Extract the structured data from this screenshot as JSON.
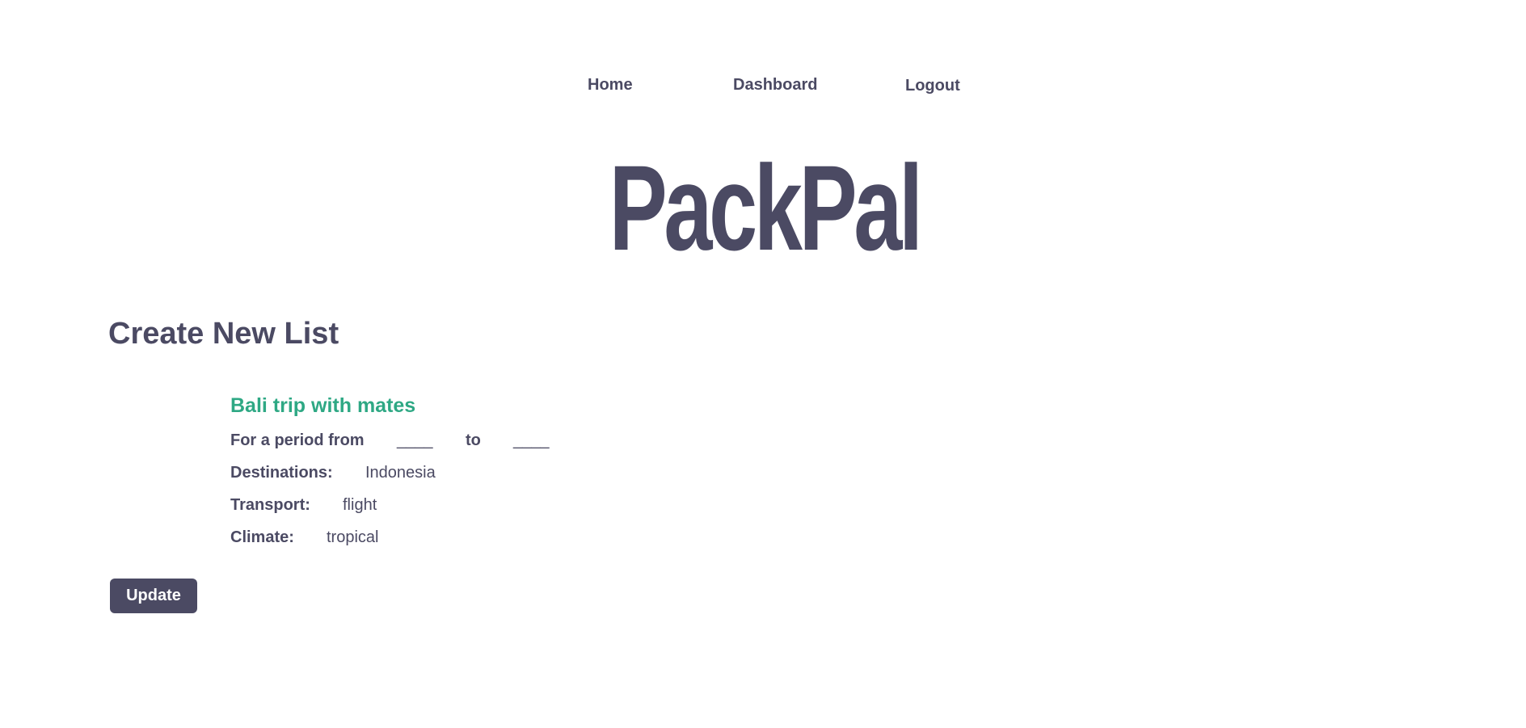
{
  "nav": {
    "home": "Home",
    "dashboard": "Dashboard",
    "logout": "Logout"
  },
  "brand": {
    "name": "PackPal"
  },
  "page": {
    "title": "Create New List"
  },
  "list": {
    "name": "Bali trip with mates",
    "period_label": "For a period from",
    "start_date": "____",
    "to_label": "to",
    "end_date": "____",
    "destinations_label": "Destinations:",
    "destinations_value": "Indonesia",
    "transport_label": "Transport:",
    "transport_value": "flight",
    "climate_label": "Climate:",
    "climate_value": "tropical"
  },
  "actions": {
    "update_label": "Update"
  },
  "colors": {
    "primary": "#4b4a63",
    "accent": "#2ea884",
    "background": "#ffffff"
  }
}
